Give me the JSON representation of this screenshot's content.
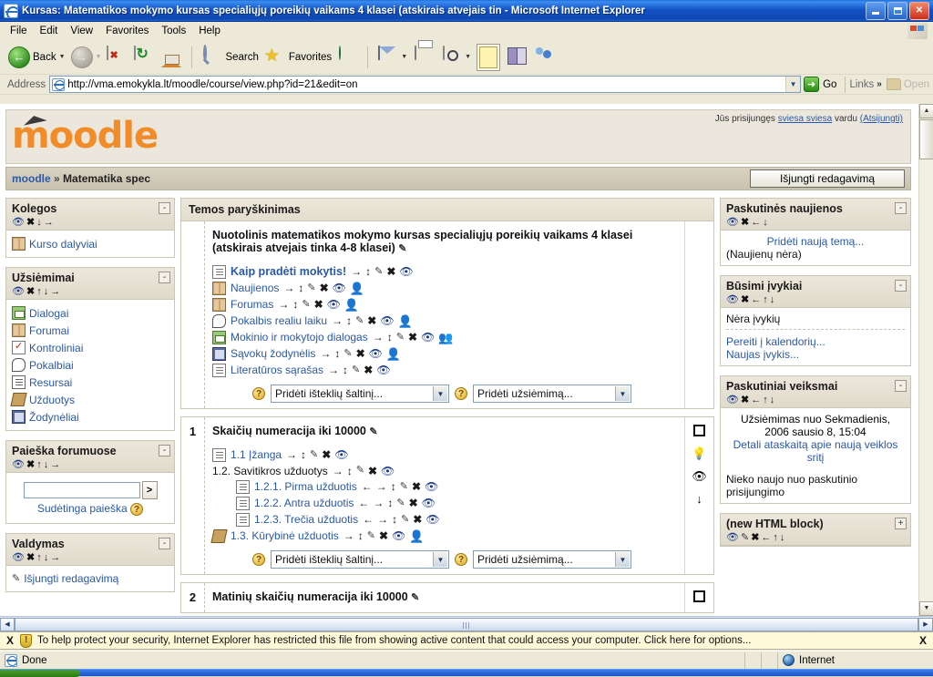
{
  "window": {
    "title": "Kursas: Matematikos mokymo kursas specialiųjų poreikių vaikams 4 klasei (atskirais atvejais tin - Microsoft Internet Explorer",
    "app_icon": "ie-document-icon"
  },
  "menu": {
    "items": [
      "File",
      "Edit",
      "View",
      "Favorites",
      "Tools",
      "Help"
    ]
  },
  "toolbar": {
    "back_label": "Back",
    "search_label": "Search",
    "favorites_label": "Favorites",
    "icons": [
      "back-icon",
      "forward-icon",
      "stop-icon",
      "refresh-icon",
      "home-icon",
      "search-icon",
      "favorites-star-icon",
      "history-globe-icon",
      "mail-icon",
      "print-icon",
      "edit-icon",
      "notepad-icon",
      "research-icon",
      "messenger-icon"
    ]
  },
  "address": {
    "label": "Address",
    "url": "http://vma.emokykla.lt/moodle/course/view.php?id=21&edit=on",
    "go_label": "Go",
    "links_label": "Links",
    "open_label": "Open"
  },
  "moodle": {
    "logo_text": "moodle",
    "login_prefix": "Jūs prisijungęs",
    "login_user": "sviesa sviesa",
    "login_middle": "vardu",
    "logout_label": "(Atsijungti)",
    "breadcrumb_home": "moodle",
    "breadcrumb_sep": "»",
    "breadcrumb_current": "Matematika spec",
    "edit_button": "Išjungti redagavimą"
  },
  "left_blocks": [
    {
      "title": "Kolegos",
      "tools": [
        "eye",
        "x",
        "down",
        "right"
      ],
      "collapse": "-",
      "items": [
        {
          "label": "Kurso dalyviai",
          "icon": "forum-people-icon"
        }
      ]
    },
    {
      "title": "Užsiėmimai",
      "tools": [
        "eye",
        "x",
        "up",
        "down",
        "right"
      ],
      "collapse": "-",
      "items": [
        {
          "label": "Dialogai",
          "icon": "dialog-icon"
        },
        {
          "label": "Forumai",
          "icon": "forum-people-icon"
        },
        {
          "label": "Kontroliniai",
          "icon": "quiz-icon"
        },
        {
          "label": "Pokalbiai",
          "icon": "chat-icon"
        },
        {
          "label": "Resursai",
          "icon": "resource-icon"
        },
        {
          "label": "Užduotys",
          "icon": "assignment-icon"
        },
        {
          "label": "Žodynėliai",
          "icon": "glossary-icon"
        }
      ]
    },
    {
      "title": "Paieška forumuose",
      "tools": [
        "eye",
        "x",
        "up",
        "down",
        "right"
      ],
      "collapse": "-",
      "search_value": "",
      "search_button": ">",
      "advanced_label": "Sudėtinga paieška",
      "help_icon": "help-question-icon"
    },
    {
      "title": "Valdymas",
      "tools": [
        "eye",
        "x",
        "up",
        "down",
        "right"
      ],
      "collapse": "-",
      "items": [
        {
          "label": "Išjungti redagavimą",
          "icon": "pencil-icon"
        }
      ]
    }
  ],
  "main": {
    "topic_header": "Temos paryškinimas",
    "intro_title_line1": "Nuotolinis matematikos mokymo kursas specialiųjų poreikių vaikams 4 klasei",
    "intro_title_line2": "(atskirais atvejais tinka 4-8 klasei)",
    "intro_activities": [
      {
        "label": "Kaip pradėti mokytis!",
        "icon": "resource-icon",
        "bold": true,
        "icons": [
          "right",
          "updown",
          "pencil",
          "x",
          "eye"
        ]
      },
      {
        "label": "Naujienos",
        "icon": "forum-people-icon",
        "bold": false,
        "icons": [
          "right",
          "updown",
          "pencil",
          "x",
          "eye",
          "group"
        ]
      },
      {
        "label": "Forumas",
        "icon": "forum-people-icon",
        "bold": false,
        "icons": [
          "right",
          "updown",
          "pencil",
          "x",
          "eye",
          "group"
        ]
      },
      {
        "label": "Pokalbis realiu laiku",
        "icon": "chat-icon",
        "bold": false,
        "icons": [
          "right",
          "updown",
          "pencil",
          "x",
          "eye",
          "group"
        ]
      },
      {
        "label": "Mokinio ir mokytojo dialogas",
        "icon": "dialog-icon",
        "bold": false,
        "icons": [
          "right",
          "updown",
          "pencil",
          "x",
          "eye",
          "group2"
        ]
      },
      {
        "label": "Sąvokų žodynėlis",
        "icon": "glossary-icon",
        "bold": false,
        "icons": [
          "right",
          "updown",
          "pencil",
          "x",
          "eye",
          "group"
        ]
      },
      {
        "label": "Literatūros sąrašas",
        "icon": "resource-icon",
        "bold": false,
        "icons": [
          "right",
          "updown",
          "pencil",
          "x",
          "eye"
        ]
      }
    ],
    "add_resource_label": "Pridėti išteklių šaltinį...",
    "add_activity_label": "Pridėti užsiėmimą...",
    "sections": [
      {
        "number": "1",
        "heading": "Skaičių numeracija iki 10000",
        "heading_edit_icon": "pencil-icon",
        "side_icons": [
          "square",
          "lightbulb",
          "eye",
          "down-arrow"
        ],
        "activities": [
          {
            "label": "1.1 Įžanga",
            "icon": "resource-icon",
            "indent": false,
            "icons": [
              "right",
              "updown",
              "pencil",
              "x",
              "eye"
            ]
          },
          {
            "label": "1.2. Savitikros užduotys",
            "icon": "none",
            "indent": false,
            "plain": true,
            "icons": [
              "right",
              "updown",
              "pencil",
              "x",
              "eye"
            ]
          },
          {
            "label": "1.2.1. Pirma užduotis",
            "icon": "resource-icon",
            "indent": true,
            "icons": [
              "left",
              "right",
              "updown",
              "pencil",
              "x",
              "eye"
            ]
          },
          {
            "label": "1.2.2. Antra užduotis",
            "icon": "resource-icon",
            "indent": true,
            "icons": [
              "left",
              "right",
              "updown",
              "pencil",
              "x",
              "eye"
            ]
          },
          {
            "label": "1.2.3. Trečia užduotis",
            "icon": "resource-icon",
            "indent": true,
            "icons": [
              "left",
              "right",
              "updown",
              "pencil",
              "x",
              "eye"
            ]
          },
          {
            "label": "1.3. Kūrybinė užduotis",
            "icon": "assignment-icon",
            "indent": false,
            "icons": [
              "right",
              "updown",
              "pencil",
              "x",
              "eye",
              "group"
            ]
          }
        ]
      },
      {
        "number": "2",
        "heading": "Matinių skaičių numeracija iki 10000",
        "heading_edit_icon": "pencil-icon",
        "side_icons": [
          "square"
        ],
        "activities": []
      }
    ]
  },
  "right_blocks": [
    {
      "title": "Paskutinės naujienos",
      "tools": [
        "eye",
        "x",
        "left",
        "down"
      ],
      "collapse": "-",
      "link": "Pridėti naują temą...",
      "text": "(Naujienų nėra)"
    },
    {
      "title": "Būsimi įvykiai",
      "tools": [
        "eye",
        "x",
        "left",
        "up",
        "down"
      ],
      "collapse": "-",
      "text": "Nėra įvykių",
      "links": [
        "Pereiti į kalendorių...",
        "Naujas įvykis..."
      ]
    },
    {
      "title": "Paskutiniai veiksmai",
      "tools": [
        "eye",
        "x",
        "left",
        "up",
        "down"
      ],
      "collapse": "-",
      "line1": "Užsiėmimas nuo Sekmadienis,",
      "line2": "2006 sausio 8, 15:04",
      "link": "Detali ataskaitą apie naują veiklos sritį",
      "footer": "Nieko naujo nuo paskutinio prisijungimo"
    },
    {
      "title": "(new HTML block)",
      "tools": [
        "eye",
        "pencil",
        "x",
        "left",
        "up",
        "down"
      ],
      "collapse": "+"
    }
  ],
  "infobar": {
    "text": "To help protect your security, Internet Explorer has restricted this file from showing active content that could access your computer. Click here for options...",
    "close_label": "X",
    "shield_icon": "security-shield-icon"
  },
  "statusbar": {
    "status": "Done",
    "zone": "Internet"
  },
  "colors": {
    "link": "#2a58a8",
    "moodle_orange": "#f28c28",
    "block_bg": "#ece7db",
    "page_bg": "#ffffff"
  }
}
